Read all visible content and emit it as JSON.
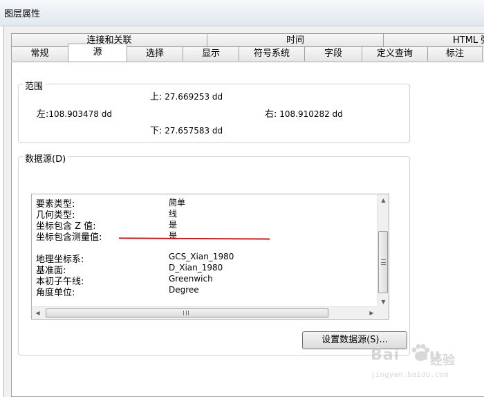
{
  "window": {
    "title": "图层属性"
  },
  "tabs_back": [
    "连接和关联",
    "时间",
    "HTML 弹"
  ],
  "tabs_front": [
    "常规",
    "源",
    "选择",
    "显示",
    "符号系统",
    "字段",
    "定义查询",
    "标注"
  ],
  "active_tab": "源",
  "extent": {
    "group_title": "范围",
    "top_label": "上:",
    "top_value": "27.669253 dd",
    "left_label": "左:",
    "left_value": "108.903478 dd",
    "right_label": "右:",
    "right_value": "108.910282 dd",
    "bottom_label": "下:",
    "bottom_value": "27.657583 dd"
  },
  "datasource": {
    "group_title": "数据源(D)",
    "rows": [
      {
        "key": "要素类型:",
        "value": "简单"
      },
      {
        "key": "几何类型:",
        "value": "线"
      },
      {
        "key": "坐标包含 Z 值:",
        "value": "是"
      },
      {
        "key": "坐标包含测量值:",
        "value": "是"
      },
      {
        "key": "地理坐标系:",
        "value": "GCS_Xian_1980"
      },
      {
        "key": "基准面:",
        "value": "D_Xian_1980"
      },
      {
        "key": "本初子午线:",
        "value": "Greenwich"
      },
      {
        "key": "角度单位:",
        "value": "Degree"
      }
    ],
    "button_label": "设置数据源(S)...",
    "red_line_color": "#c22020"
  },
  "watermark": {
    "logo_text": "Bai",
    "logo_text2": "du",
    "brand": "经验",
    "url": "jingyan.baidu.com"
  }
}
